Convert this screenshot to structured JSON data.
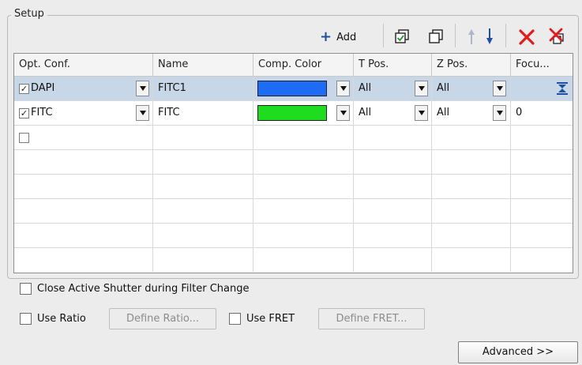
{
  "group_title": "Setup",
  "toolbar": {
    "add_label": "Add",
    "icons": [
      "copy-icon",
      "duplicate-icon",
      "move-up-icon",
      "move-down-icon",
      "delete-icon",
      "delete-all-icon"
    ]
  },
  "grid": {
    "columns": [
      "Opt. Conf.",
      "Name",
      "Comp. Color",
      "T Pos.",
      "Z Pos.",
      "Focu..."
    ],
    "rows": [
      {
        "checked": true,
        "opt_conf": "DAPI",
        "name": "FITC1",
        "color": "#1e6cf5",
        "t_pos": "All",
        "z_pos": "All",
        "focus": "",
        "focus_icon": "focus-range-icon",
        "selected": true
      },
      {
        "checked": true,
        "opt_conf": "FITC",
        "name": "FITC",
        "color": "#1edc1e",
        "t_pos": "All",
        "z_pos": "All",
        "focus": "0",
        "selected": false
      },
      {
        "checked": false,
        "opt_conf": "",
        "name": "",
        "t_pos": "",
        "z_pos": "",
        "focus": ""
      }
    ]
  },
  "options": {
    "close_shutter_label": "Close Active Shutter during Filter Change",
    "use_ratio_label": "Use Ratio",
    "define_ratio_label": "Define Ratio...",
    "use_fret_label": "Use FRET",
    "define_fret_label": "Define FRET..."
  },
  "advanced_label": "Advanced >>"
}
